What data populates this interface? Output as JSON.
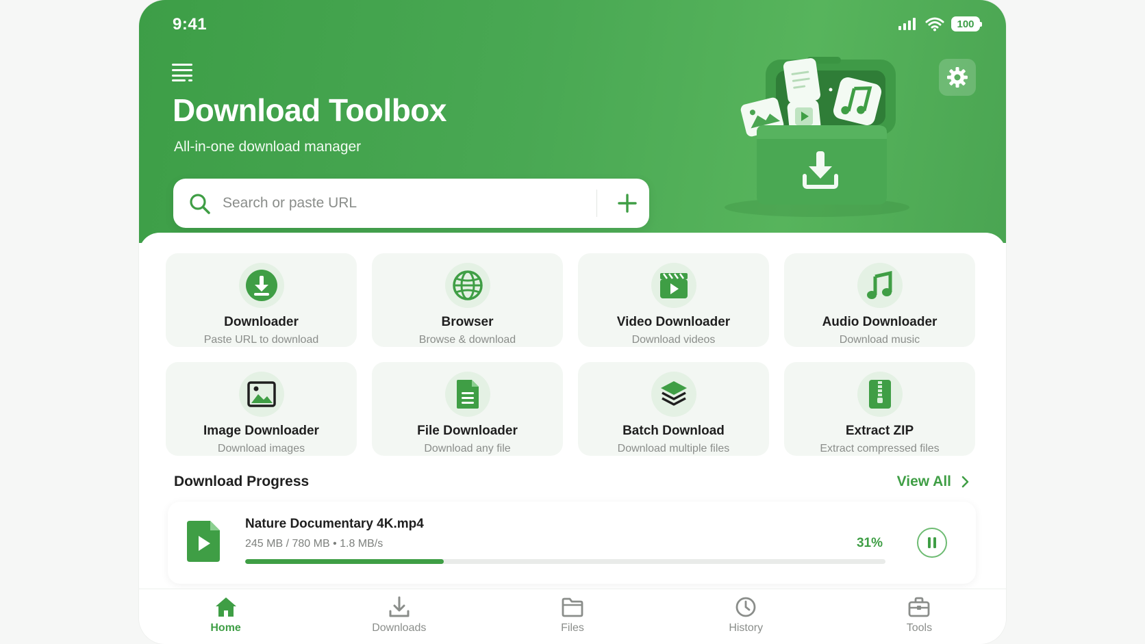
{
  "status": {
    "time": "9:41",
    "battery": "100"
  },
  "header": {
    "title": "Download Toolbox",
    "subtitle": "All-in-one download manager",
    "menu_icon": "menu-icon",
    "settings_icon": "gear-icon"
  },
  "search": {
    "placeholder": "Search or paste URL",
    "value": "",
    "add_icon": "plus-icon"
  },
  "tools": [
    {
      "title": "Downloader",
      "subtitle": "Paste URL to download",
      "icon": "download-icon"
    },
    {
      "title": "Browser",
      "subtitle": "Browse & download",
      "icon": "globe-icon"
    },
    {
      "title": "Video Downloader",
      "subtitle": "Download videos",
      "icon": "video-icon"
    },
    {
      "title": "Audio Downloader",
      "subtitle": "Download music",
      "icon": "music-icon"
    },
    {
      "title": "Image Downloader",
      "subtitle": "Download images",
      "icon": "image-icon"
    },
    {
      "title": "File Downloader",
      "subtitle": "Download any file",
      "icon": "file-icon"
    },
    {
      "title": "Batch Download",
      "subtitle": "Download multiple files",
      "icon": "layers-icon"
    },
    {
      "title": "Extract ZIP",
      "subtitle": "Extract compressed files",
      "icon": "zip-icon"
    }
  ],
  "progress": {
    "section_title": "Download Progress",
    "view_all": "View All",
    "items": [
      {
        "name": "Nature Documentary 4K.mp4",
        "meta": "245 MB / 780 MB • 1.8 MB/s",
        "percent_label": "31%",
        "percent": 31
      }
    ]
  },
  "tabs": [
    {
      "label": "Home",
      "icon": "home-icon",
      "active": true
    },
    {
      "label": "Downloads",
      "icon": "download-tray-icon",
      "active": false
    },
    {
      "label": "Files",
      "icon": "folder-icon",
      "active": false
    },
    {
      "label": "History",
      "icon": "clock-icon",
      "active": false
    },
    {
      "label": "Tools",
      "icon": "toolbox-icon",
      "active": false
    }
  ],
  "colors": {
    "accent": "#3f9e45",
    "header_bg": "#4aa552",
    "card_bg": "#f3f7f3"
  }
}
